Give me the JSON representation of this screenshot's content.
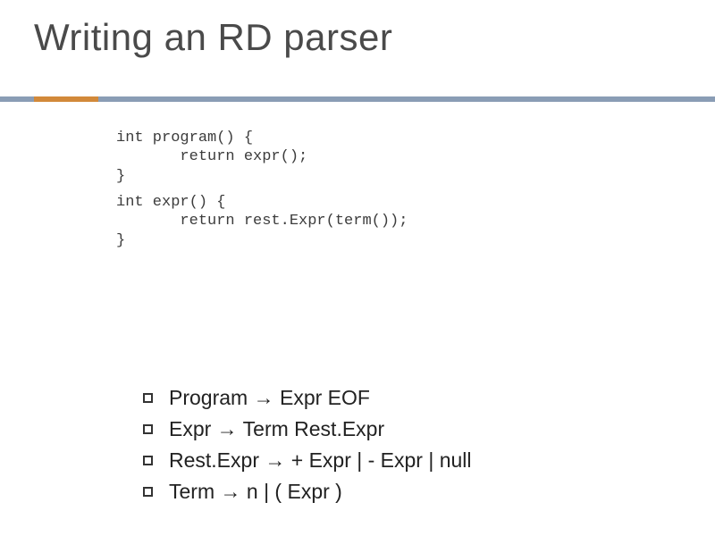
{
  "title": "Writing an RD parser",
  "code": {
    "block1": "int program() {\n       return expr();\n}",
    "block2": "int expr() {\n       return rest.Expr(term());\n}"
  },
  "grammar": {
    "rule1": "Program → Expr EOF",
    "rule2": "Expr → Term Rest.Expr",
    "rule3": "Rest.Expr → + Expr | - Expr | null",
    "rule4": "Term → n | ( Expr )"
  }
}
